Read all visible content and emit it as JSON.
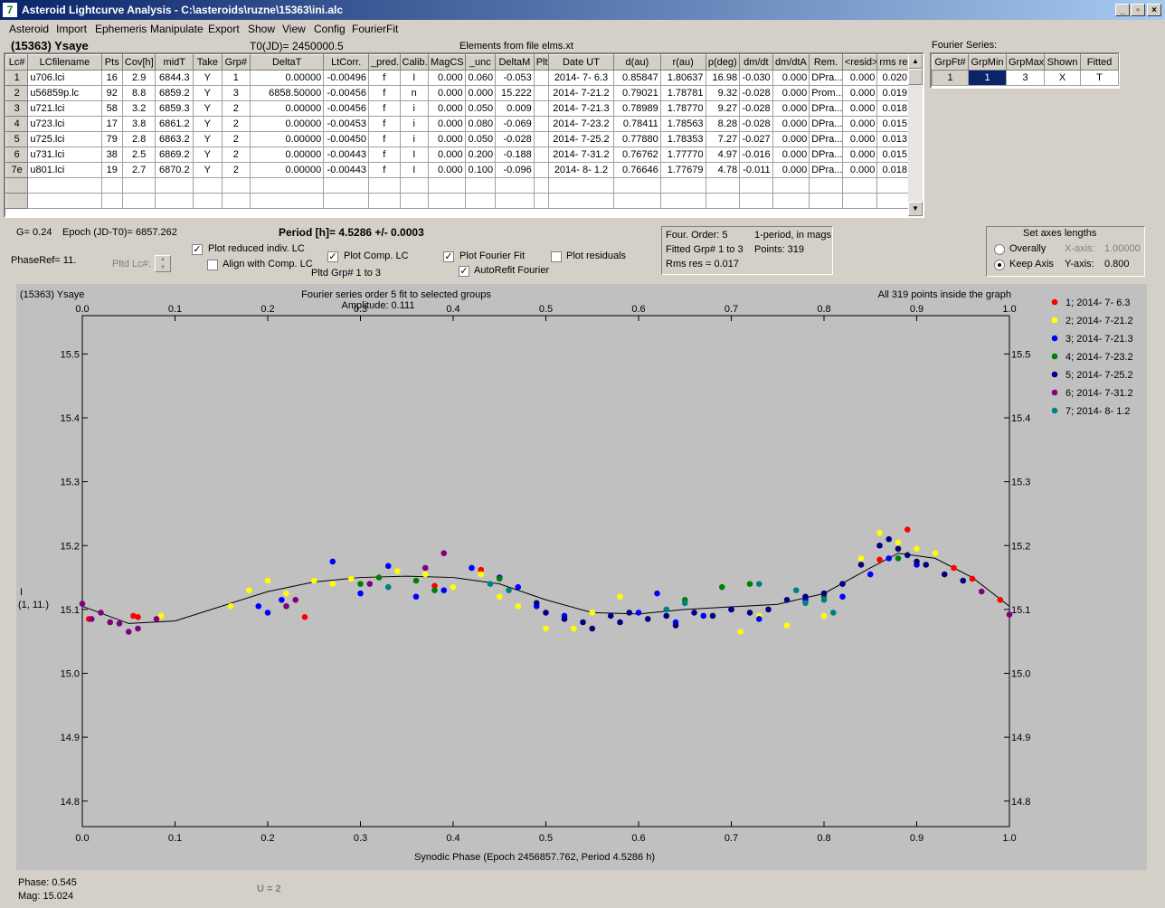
{
  "window": {
    "title": "Asteroid Lightcurve Analysis - C:\\asteroids\\ruzne\\15363\\ini.alc",
    "icon": "app-icon"
  },
  "menu": [
    "Asteroid",
    "Import",
    "Ephemeris",
    "Manipulate",
    "Export",
    "Show",
    "View",
    "Config",
    "FourierFit"
  ],
  "header": {
    "object": "(15363) Ysaye",
    "t0": "T0(JD)= 2450000.5",
    "elements": "Elements from file elms.xt",
    "fourier_series": "Fourier Series:"
  },
  "lc_table": {
    "columns": [
      "Lc#",
      "LCfilename",
      "Pts",
      "Cov[h]",
      "midT",
      "Take",
      "Grp#",
      "DeltaT",
      "LtCorr.",
      "_pred.",
      "Calib.",
      "MagCS",
      "_unc",
      "DeltaM",
      "Plt",
      "Date UT",
      "d(au)",
      "r(au)",
      "p(deg)",
      "dm/dt",
      "dm/dtA",
      "Rem.",
      "<resid>",
      "rms res"
    ],
    "rows": [
      [
        "1",
        "u706.lci",
        "16",
        "2.9",
        "6844.3",
        "Y",
        "1",
        "0.00000",
        "-0.00496",
        "f",
        "I",
        "0.000",
        "0.060",
        "-0.053",
        "",
        "2014- 7- 6.3",
        "0.85847",
        "1.80637",
        "16.98",
        "-0.030",
        "0.000",
        "DPra...",
        "0.000",
        "0.020"
      ],
      [
        "2",
        "u56859p.lc",
        "92",
        "8.8",
        "6859.2",
        "Y",
        "3",
        "6858.50000",
        "-0.00456",
        "f",
        "n",
        "0.000",
        "0.000",
        "15.222",
        "",
        "2014- 7-21.2",
        "0.79021",
        "1.78781",
        "9.32",
        "-0.028",
        "0.000",
        "Prom...",
        "0.000",
        "0.019"
      ],
      [
        "3",
        "u721.lci",
        "58",
        "3.2",
        "6859.3",
        "Y",
        "2",
        "0.00000",
        "-0.00456",
        "f",
        "i",
        "0.000",
        "0.050",
        "0.009",
        "",
        "2014- 7-21.3",
        "0.78989",
        "1.78770",
        "9.27",
        "-0.028",
        "0.000",
        "DPra...",
        "0.000",
        "0.018"
      ],
      [
        "4",
        "u723.lci",
        "17",
        "3.8",
        "6861.2",
        "Y",
        "2",
        "0.00000",
        "-0.00453",
        "f",
        "i",
        "0.000",
        "0.080",
        "-0.069",
        "",
        "2014- 7-23.2",
        "0.78411",
        "1.78563",
        "8.28",
        "-0.028",
        "0.000",
        "DPra...",
        "0.000",
        "0.015"
      ],
      [
        "5",
        "u725.lci",
        "79",
        "2.8",
        "6863.2",
        "Y",
        "2",
        "0.00000",
        "-0.00450",
        "f",
        "i",
        "0.000",
        "0.050",
        "-0.028",
        "",
        "2014- 7-25.2",
        "0.77880",
        "1.78353",
        "7.27",
        "-0.027",
        "0.000",
        "DPra...",
        "0.000",
        "0.013"
      ],
      [
        "6",
        "u731.lci",
        "38",
        "2.5",
        "6869.2",
        "Y",
        "2",
        "0.00000",
        "-0.00443",
        "f",
        "I",
        "0.000",
        "0.200",
        "-0.188",
        "",
        "2014- 7-31.2",
        "0.76762",
        "1.77770",
        "4.97",
        "-0.016",
        "0.000",
        "DPra...",
        "0.000",
        "0.015"
      ],
      [
        "7e",
        "u801.lci",
        "19",
        "2.7",
        "6870.2",
        "Y",
        "2",
        "0.00000",
        "-0.00443",
        "f",
        "I",
        "0.000",
        "0.100",
        "-0.096",
        "",
        "2014- 8- 1.2",
        "0.76646",
        "1.77679",
        "4.78",
        "-0.011",
        "0.000",
        "DPra...",
        "0.000",
        "0.018"
      ]
    ]
  },
  "fourier_table": {
    "columns": [
      "GrpFt#",
      "GrpMin",
      "GrpMax",
      "Shown",
      "Fitted"
    ],
    "row": [
      "1",
      "1",
      "3",
      "X",
      "T"
    ]
  },
  "info": {
    "g": "G= 0.24",
    "epoch": "Epoch (JD-T0)= 6857.262",
    "period": "Period [h]= 4.5286 +/- 0.0003",
    "phaseref": "PhaseRef= 11.",
    "pltd_lc": "Pltd Lc#:",
    "pltd_grp": "Pltd Grp#  1   to   3",
    "four_order": "Four. Order:  5",
    "one_period": "1-period, in mags",
    "fitted_grp": "Fitted Grp# 1 to 3",
    "points": "Points: 319",
    "rms": "Rms res     = 0.017"
  },
  "checks": {
    "plot_reduced": {
      "label": "Plot reduced indiv. LC",
      "checked": true
    },
    "align_comp": {
      "label": "Align with Comp. LC",
      "checked": false
    },
    "plot_comp": {
      "label": "Plot Comp. LC",
      "checked": true
    },
    "plot_fourier": {
      "label": "Plot Fourier Fit",
      "checked": true
    },
    "autorefit": {
      "label": "AutoRefit Fourier",
      "checked": true
    },
    "plot_resid": {
      "label": "Plot residuals",
      "checked": false
    }
  },
  "axes_box": {
    "title": "Set axes lengths",
    "overally": "Overally",
    "keep": "Keep Axis",
    "xaxis_label": "X-axis:",
    "xaxis_val": "1.00000",
    "yaxis_label": "Y-axis:",
    "yaxis_val": "0.800"
  },
  "plot": {
    "top_left": "(15363) Ysaye",
    "title": "Fourier series order 5 fit to selected groups",
    "amplitude": "Amplitude: 0.111",
    "points_note": "All 319 points inside the graph",
    "ylabel_1": "I",
    "ylabel_2": "(1, 11.)"
  },
  "status": {
    "phase": "Phase:  0.545",
    "mag": "Mag:    15.024",
    "u": "U = 2"
  },
  "chart_data": {
    "type": "scatter",
    "xlabel": "Synodic Phase (Epoch 2456857.762, Period 4.5286 h)",
    "ylabel": "I (1, 11.)",
    "xlim": [
      0.0,
      1.0
    ],
    "ylim": [
      15.56,
      14.76
    ],
    "x_ticks": [
      "0.0",
      "0.1",
      "0.2",
      "0.3",
      "0.4",
      "0.5",
      "0.6",
      "0.7",
      "0.8",
      "0.9",
      "1.0"
    ],
    "y_ticks": [
      "14.8",
      "14.9",
      "15.0",
      "15.1",
      "15.2",
      "15.3",
      "15.4",
      "15.5"
    ],
    "grid": false,
    "legend": "right",
    "fit_curve": {
      "x": [
        0.0,
        0.05,
        0.1,
        0.15,
        0.2,
        0.25,
        0.3,
        0.35,
        0.4,
        0.45,
        0.5,
        0.55,
        0.6,
        0.65,
        0.7,
        0.75,
        0.8,
        0.85,
        0.88,
        0.92,
        0.96,
        1.0
      ],
      "y": [
        15.105,
        15.078,
        15.082,
        15.105,
        15.128,
        15.143,
        15.15,
        15.152,
        15.15,
        15.14,
        15.115,
        15.095,
        15.093,
        15.1,
        15.104,
        15.108,
        15.125,
        15.165,
        15.188,
        15.18,
        15.15,
        15.105
      ]
    },
    "series": [
      {
        "name": "1; 2014- 7- 6.3",
        "color": "#ff0000",
        "x": [
          0.007,
          0.055,
          0.06,
          0.24,
          0.38,
          0.43,
          0.86,
          0.89,
          0.94,
          0.96,
          0.99
        ],
        "y": [
          15.085,
          15.09,
          15.088,
          15.088,
          15.137,
          15.162,
          15.178,
          15.225,
          15.165,
          15.148,
          15.115
        ]
      },
      {
        "name": "2; 2014- 7-21.2",
        "color": "#ffff00",
        "x": [
          0.085,
          0.16,
          0.18,
          0.2,
          0.22,
          0.25,
          0.27,
          0.29,
          0.32,
          0.34,
          0.37,
          0.4,
          0.43,
          0.45,
          0.47,
          0.5,
          0.53,
          0.55,
          0.58,
          0.62,
          0.71,
          0.73,
          0.76,
          0.8,
          0.84,
          0.86,
          0.88,
          0.9,
          0.92
        ],
        "y": [
          15.09,
          15.105,
          15.13,
          15.145,
          15.125,
          15.145,
          15.14,
          15.148,
          15.15,
          15.16,
          15.155,
          15.135,
          15.155,
          15.12,
          15.105,
          15.07,
          15.07,
          15.095,
          15.12,
          15.125,
          15.065,
          15.09,
          15.075,
          15.09,
          15.18,
          15.22,
          15.205,
          15.195,
          15.188
        ]
      },
      {
        "name": "3; 2014- 7-21.3",
        "color": "#0000ff",
        "x": [
          0.19,
          0.2,
          0.215,
          0.27,
          0.3,
          0.33,
          0.36,
          0.39,
          0.42,
          0.45,
          0.47,
          0.49,
          0.52,
          0.6,
          0.62,
          0.64,
          0.67,
          0.7,
          0.73,
          0.78,
          0.82,
          0.85,
          0.87,
          0.9
        ],
        "y": [
          15.105,
          15.095,
          15.115,
          15.175,
          15.125,
          15.168,
          15.12,
          15.13,
          15.165,
          15.15,
          15.135,
          15.105,
          15.09,
          15.095,
          15.125,
          15.08,
          15.09,
          15.1,
          15.085,
          15.115,
          15.12,
          15.155,
          15.18,
          15.17
        ]
      },
      {
        "name": "4; 2014- 7-23.2",
        "color": "#008000",
        "x": [
          0.3,
          0.32,
          0.36,
          0.38,
          0.45,
          0.65,
          0.69,
          0.72,
          0.8,
          0.88
        ],
        "y": [
          15.14,
          15.15,
          15.145,
          15.13,
          15.148,
          15.115,
          15.135,
          15.14,
          15.12,
          15.18
        ]
      },
      {
        "name": "5; 2014- 7-25.2",
        "color": "#000080",
        "x": [
          0.49,
          0.5,
          0.52,
          0.54,
          0.55,
          0.57,
          0.58,
          0.59,
          0.61,
          0.63,
          0.64,
          0.66,
          0.68,
          0.7,
          0.72,
          0.74,
          0.76,
          0.78,
          0.8,
          0.82,
          0.84,
          0.86,
          0.87,
          0.88,
          0.89,
          0.9,
          0.91,
          0.93,
          0.95
        ],
        "y": [
          15.11,
          15.095,
          15.085,
          15.08,
          15.07,
          15.09,
          15.08,
          15.095,
          15.085,
          15.09,
          15.075,
          15.095,
          15.09,
          15.1,
          15.095,
          15.1,
          15.115,
          15.12,
          15.125,
          15.14,
          15.17,
          15.2,
          15.21,
          15.195,
          15.185,
          15.175,
          15.17,
          15.155,
          15.145
        ]
      },
      {
        "name": "6; 2014- 7-31.2",
        "color": "#800080",
        "x": [
          0.0,
          0.01,
          0.02,
          0.03,
          0.04,
          0.05,
          0.06,
          0.08,
          0.22,
          0.23,
          0.31,
          0.37,
          0.39,
          0.97,
          1.0
        ],
        "y": [
          15.109,
          15.085,
          15.095,
          15.08,
          15.078,
          15.065,
          15.07,
          15.085,
          15.105,
          15.115,
          15.14,
          15.165,
          15.188,
          15.128,
          15.092
        ]
      },
      {
        "name": "7; 2014- 8- 1.2",
        "color": "#008080",
        "x": [
          0.33,
          0.44,
          0.46,
          0.63,
          0.65,
          0.73,
          0.77,
          0.78,
          0.8,
          0.81
        ],
        "y": [
          15.135,
          15.14,
          15.13,
          15.1,
          15.11,
          15.14,
          15.13,
          15.11,
          15.115,
          15.095
        ]
      }
    ]
  }
}
